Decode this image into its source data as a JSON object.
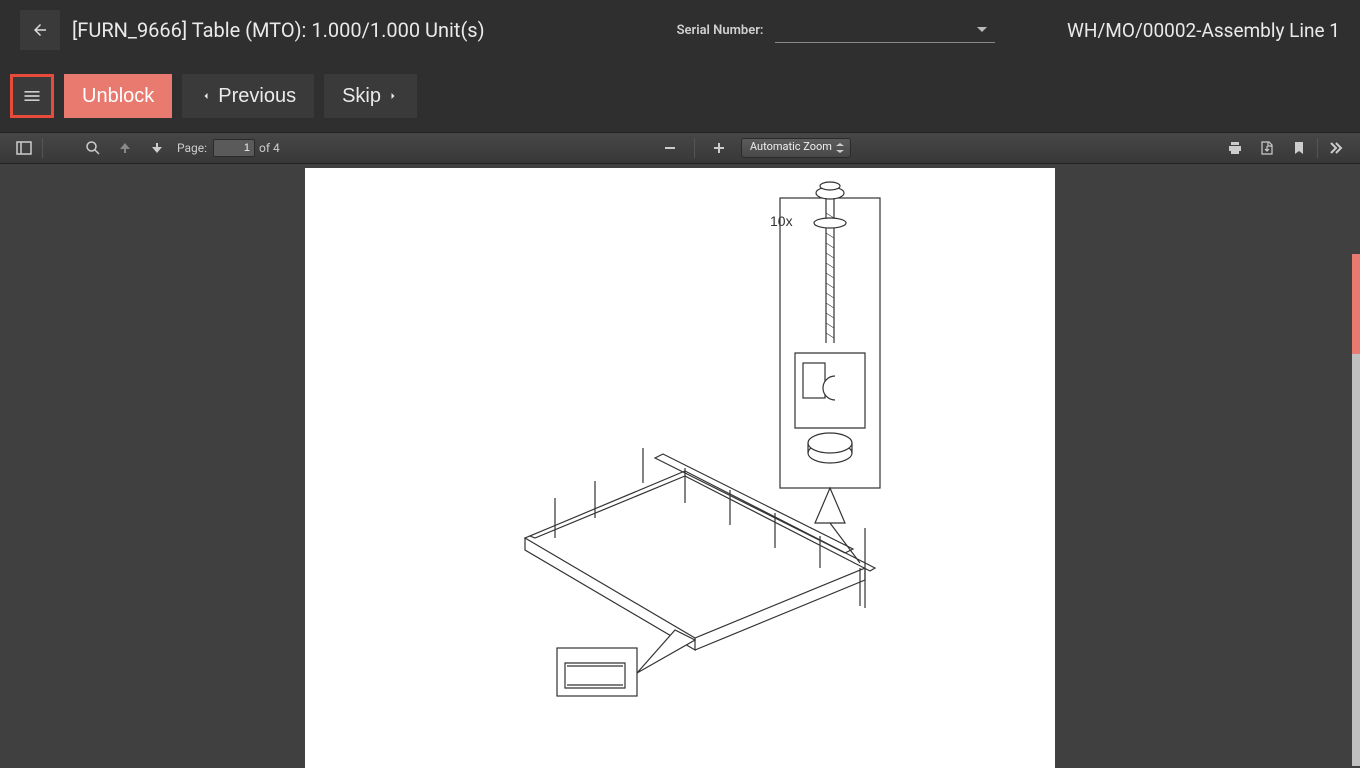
{
  "header": {
    "product_title": "[FURN_9666] Table (MTO): 1.000/1.000 Unit(s)",
    "serial_label": "Serial Number:",
    "serial_value": "",
    "mo_title": "WH/MO/00002-Assembly Line 1"
  },
  "actions": {
    "unblock": "Unblock",
    "previous": "Previous",
    "skip": "Skip"
  },
  "pdf": {
    "page_label": "Page:",
    "current_page": "1",
    "page_count": "of 4",
    "zoom_label": "Automatic Zoom"
  },
  "diagram": {
    "qty_label": "10x"
  }
}
